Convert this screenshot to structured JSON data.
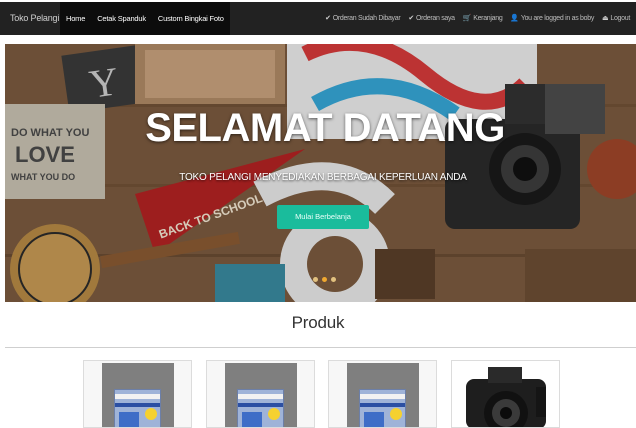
{
  "navbar": {
    "brand": "Toko Pelangi",
    "left_links": [
      "Home",
      "Cetak Spanduk",
      "Custom Bingkai Foto"
    ],
    "right_links": [
      {
        "icon": "check-icon",
        "glyph": "✔",
        "label": "Orderan Sudah Dibayar"
      },
      {
        "icon": "check-icon",
        "glyph": "✔",
        "label": "Orderan saya"
      },
      {
        "icon": "cart-icon",
        "glyph": "🛒",
        "label": "Keranjang"
      },
      {
        "icon": "user-icon",
        "glyph": "👤",
        "label": "You are logged in as boby"
      },
      {
        "icon": "logout-icon",
        "glyph": "⏏",
        "label": "Logout"
      }
    ]
  },
  "hero": {
    "title": "SELAMAT DATANG",
    "subtitle": "TOKO PELANGI MENYEDIAKAN BERBAGAI KEPERLUAN ANDA",
    "button_label": "Mulai Berbelanja",
    "button_color": "#1abc9c",
    "slide_count": 3,
    "active_slide": 2
  },
  "products": {
    "heading": "Produk",
    "items": [
      {
        "kind": "paper-pack"
      },
      {
        "kind": "paper-pack"
      },
      {
        "kind": "paper-pack"
      },
      {
        "kind": "camera"
      }
    ]
  }
}
